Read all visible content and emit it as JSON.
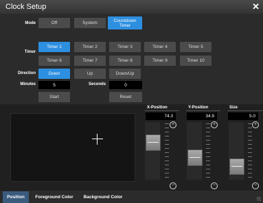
{
  "window": {
    "title": "Clock Setup",
    "close_icon": "close-icon"
  },
  "mode": {
    "label": "Mode",
    "options": [
      "Off",
      "System",
      "Countdown Timer"
    ],
    "selected": "Countdown Timer"
  },
  "timer": {
    "label": "Timer",
    "options": [
      "Timer 1",
      "Timer 2",
      "Timer 3",
      "Timer 4",
      "Timer 5",
      "Timer 6",
      "Timer 7",
      "Timer 8",
      "Timer 9",
      "Timer 10"
    ],
    "selected": "Timer 1"
  },
  "direction": {
    "label": "Direction",
    "options": [
      "Down",
      "Up",
      "Down/Up"
    ],
    "selected": "Down"
  },
  "minutes": {
    "label": "Minutes",
    "value": "5"
  },
  "seconds": {
    "label": "Seconds",
    "value": "0"
  },
  "actions": {
    "start": "Start",
    "reset": "Reset"
  },
  "sliders": [
    {
      "name": "X-Position",
      "value": "74.3",
      "level": 0.7
    },
    {
      "name": "Y-Position",
      "value": "34.9",
      "level": 0.33
    },
    {
      "name": "Size",
      "value": "5.0",
      "level": 0.12
    }
  ],
  "tabs": [
    "Position",
    "Foreground Color",
    "Background Color"
  ],
  "active_tab": "Position",
  "colors": {
    "accent": "#2d8fe0",
    "panel": "#2b2b2b",
    "active_tab": "#3b5b7e"
  }
}
